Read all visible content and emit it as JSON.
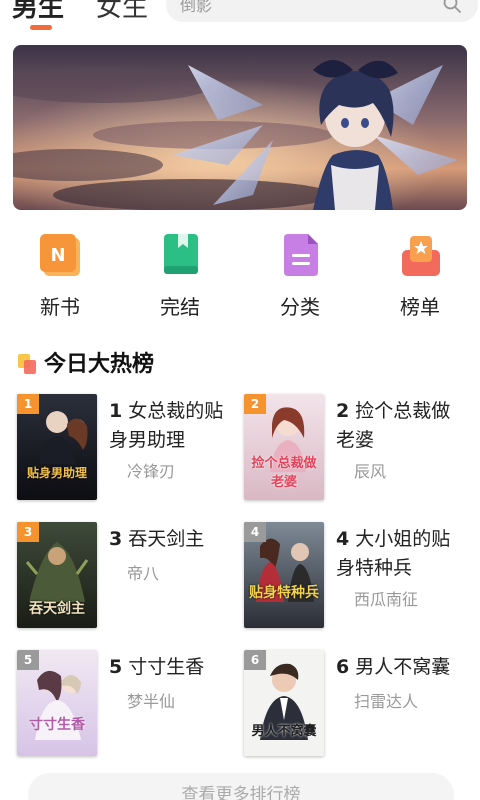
{
  "header": {
    "tabs": [
      {
        "label": "男生",
        "active": true
      },
      {
        "label": "女生",
        "active": false
      }
    ],
    "search": {
      "placeholder": "倒影"
    },
    "accent_color": "#f26a3c"
  },
  "categories": [
    {
      "label": "新书",
      "icon": "new-book-icon",
      "color": "#f7953a"
    },
    {
      "label": "完结",
      "icon": "finished-book-icon",
      "color": "#2bbf86"
    },
    {
      "label": "分类",
      "icon": "category-icon",
      "color": "#b36ad8"
    },
    {
      "label": "榜单",
      "icon": "ranking-icon",
      "color": "#f26a5c"
    }
  ],
  "hot_section": {
    "title": "今日大热榜"
  },
  "books": [
    {
      "rank": "1",
      "title": "女总裁的贴身男助理",
      "author": "冷锋刃",
      "cover_text": "贴身男助理"
    },
    {
      "rank": "2",
      "title": "捡个总裁做老婆",
      "author": "辰风",
      "cover_text": "捡个总裁做老婆"
    },
    {
      "rank": "3",
      "title": "吞天剑主",
      "author": "帝八",
      "cover_text": "吞天剑主"
    },
    {
      "rank": "4",
      "title": "大小姐的贴身特种兵",
      "author": "西瓜南征",
      "cover_text": "贴身特种兵"
    },
    {
      "rank": "5",
      "title": "寸寸生香",
      "author": "梦半仙",
      "cover_text": "寸寸生香"
    },
    {
      "rank": "6",
      "title": "男人不窝囊",
      "author": "扫雷达人",
      "cover_text": "男人不窝囊"
    }
  ],
  "more_button": {
    "label": "查看更多排行榜"
  }
}
